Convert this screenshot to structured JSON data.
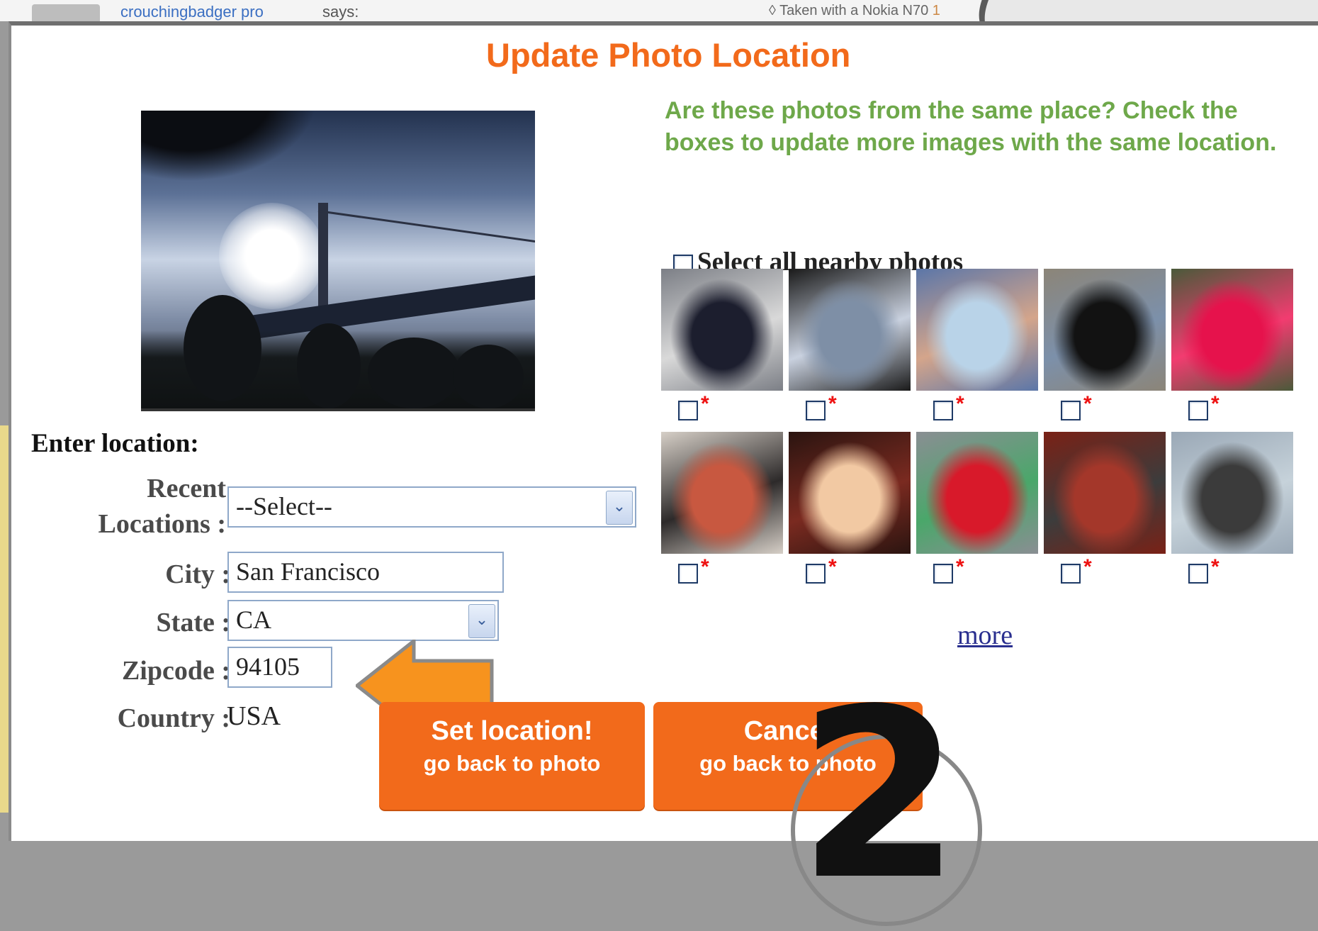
{
  "background": {
    "username": "crouchingbadger",
    "pro_badge": "pro",
    "says": "says:",
    "taken_with": "Taken with a Nokia N70",
    "taken_link": "1"
  },
  "dialog": {
    "title": "Update Photo Location",
    "question": "Are these photos from the same place? Check the boxes to update more images with the same location.",
    "select_all_label": "Select all nearby photos",
    "more_link": "more",
    "star": "*"
  },
  "form": {
    "heading": "Enter location:",
    "recent_label_1": "Recent",
    "recent_label_2": "Locations :",
    "recent_value": "--Select--",
    "city_label": "City :",
    "city_value": "San Francisco",
    "state_label": "State :",
    "state_value": "CA",
    "zip_label": "Zipcode :",
    "zip_value": "94105",
    "country_label": "Country :",
    "country_value": "USA"
  },
  "buttons": {
    "set_main": "Set location!",
    "set_sub": "go back to photo",
    "cancel_main": "Cancel",
    "cancel_sub": "go back to photo"
  },
  "annotation": {
    "step_number": "2",
    "arrow_color": "#f7931e"
  },
  "thumbnails": [
    {
      "name": "thumb-car",
      "colors": [
        "#7c7f86",
        "#1c1e2e",
        "#d9d9d9"
      ]
    },
    {
      "name": "thumb-tv-screen-1",
      "colors": [
        "#1a1a1a",
        "#7e8fa6",
        "#c9d1df"
      ]
    },
    {
      "name": "thumb-man-bandana",
      "colors": [
        "#5b76a8",
        "#b9d3e8",
        "#d4a58b"
      ]
    },
    {
      "name": "thumb-tv-screen-2",
      "colors": [
        "#8c8578",
        "#121212",
        "#7c90aa"
      ]
    },
    {
      "name": "thumb-pink-hair",
      "colors": [
        "#4a5a3a",
        "#e6124c",
        "#f23c70"
      ]
    },
    {
      "name": "thumb-poster",
      "colors": [
        "#d6cfc7",
        "#c85840",
        "#2d2a2a"
      ]
    },
    {
      "name": "thumb-lights",
      "colors": [
        "#2a1410",
        "#f2c9a3",
        "#7a2a20"
      ]
    },
    {
      "name": "thumb-fiat",
      "colors": [
        "#8a8e93",
        "#d8192a",
        "#4aa76a"
      ]
    },
    {
      "name": "thumb-udupi-palace",
      "colors": [
        "#7a2116",
        "#a4372a",
        "#3c3c3c"
      ]
    },
    {
      "name": "thumb-people",
      "colors": [
        "#9aa8b6",
        "#3b3b3b",
        "#c6d2da"
      ]
    }
  ]
}
